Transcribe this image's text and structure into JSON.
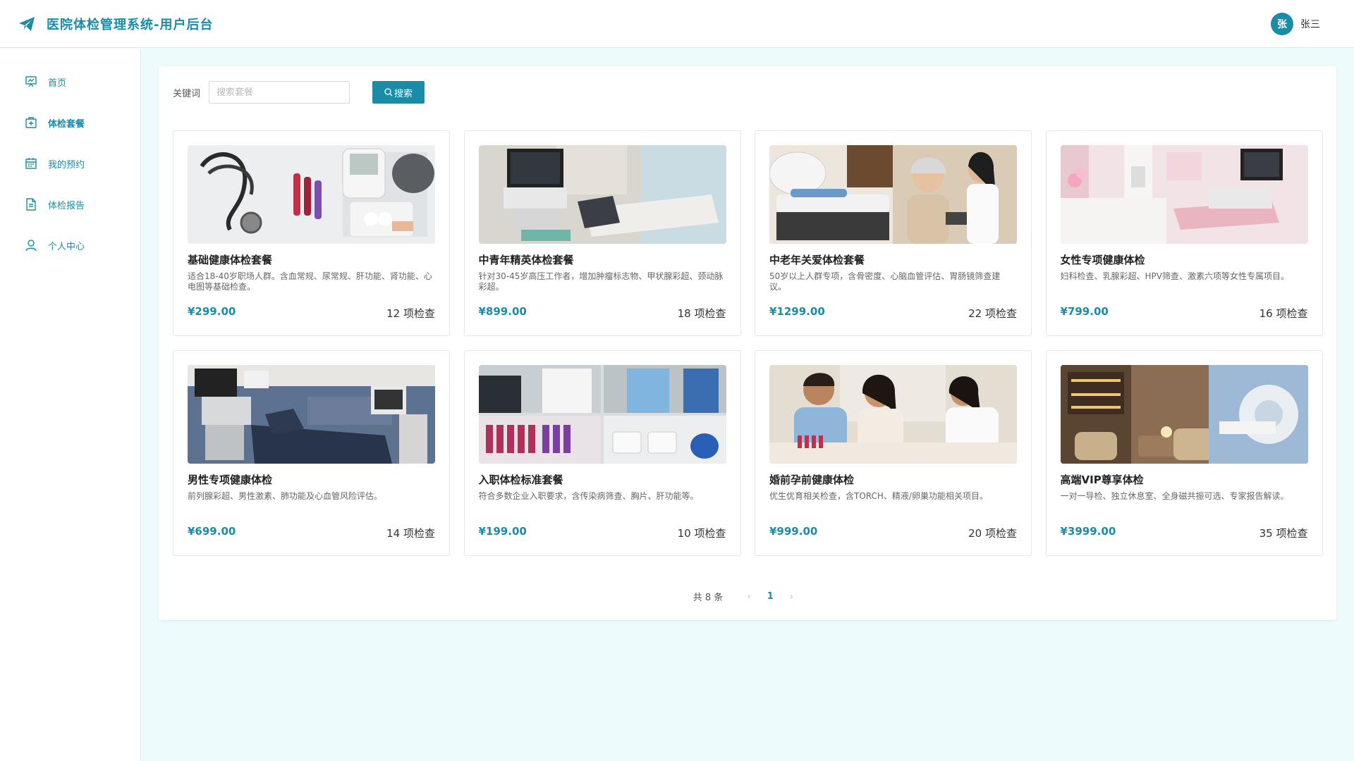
{
  "header": {
    "title": "医院体检管理系统-用户后台",
    "logo_icon": "paper-plane-icon",
    "user": {
      "avatar_text": "张",
      "name": "张三"
    }
  },
  "colors": {
    "accent": "#1a8ca8",
    "background": "#eefbfd"
  },
  "sidebar": {
    "items": [
      {
        "label": "首页",
        "icon": "presentation-board-icon",
        "active": false
      },
      {
        "label": "体检套餐",
        "icon": "medical-kit-icon",
        "active": true
      },
      {
        "label": "我的预约",
        "icon": "calendar-icon",
        "active": false
      },
      {
        "label": "体检报告",
        "icon": "document-icon",
        "active": false
      },
      {
        "label": "个人中心",
        "icon": "user-icon",
        "active": false
      }
    ]
  },
  "search": {
    "label": "关键词",
    "placeholder": "搜索套餐",
    "value": "",
    "button_label": "搜索"
  },
  "packages": [
    {
      "title": "基础健康体检套餐",
      "desc": "适合18-40岁职场人群。含血常规、尿常规、肝功能、肾功能、心电图等基础检查。",
      "price": "¥299.00",
      "count": "12 项检查"
    },
    {
      "title": "中青年精英体检套餐",
      "desc": "针对30-45岁高压工作者，增加肿瘤标志物、甲状腺彩超、颈动脉彩超。",
      "price": "¥899.00",
      "count": "18 项检查"
    },
    {
      "title": "中老年关爱体检套餐",
      "desc": "50岁以上人群专项，含骨密度、心脑血管评估、胃肠镜筛查建议。",
      "price": "¥1299.00",
      "count": "22 项检查"
    },
    {
      "title": "女性专项健康体检",
      "desc": "妇科检查、乳腺彩超、HPV筛查、激素六项等女性专属项目。",
      "price": "¥799.00",
      "count": "16 项检查"
    },
    {
      "title": "男性专项健康体检",
      "desc": "前列腺彩超、男性激素、肺功能及心血管风险评估。",
      "price": "¥699.00",
      "count": "14 项检查"
    },
    {
      "title": "入职体检标准套餐",
      "desc": "符合多数企业入职要求，含传染病筛查、胸片、肝功能等。",
      "price": "¥199.00",
      "count": "10 项检查"
    },
    {
      "title": "婚前孕前健康体检",
      "desc": "优生优育相关检查，含TORCH、精液/卵巢功能相关项目。",
      "price": "¥999.00",
      "count": "20 项检查"
    },
    {
      "title": "高端VIP尊享体检",
      "desc": "一对一导检、独立休息室、全身磁共振可选、专家报告解读。",
      "price": "¥3999.00",
      "count": "35 项检查"
    }
  ],
  "pagination": {
    "total_text": "共 8 条",
    "current_page": "1",
    "prev_icon": "chevron-left-icon",
    "next_icon": "chevron-right-icon"
  }
}
